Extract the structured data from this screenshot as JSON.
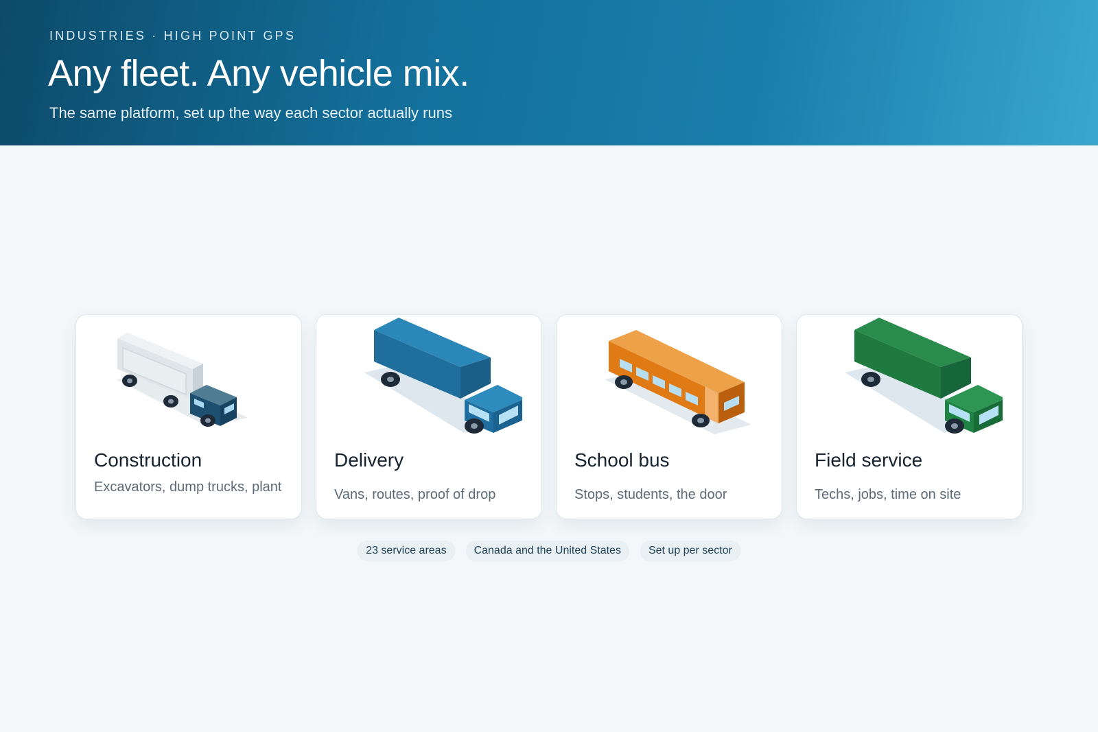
{
  "hero": {
    "eyebrow": "INDUSTRIES · HIGH POINT GPS",
    "title": "Any fleet. Any vehicle mix.",
    "subtitle": "The same platform, set up the way each sector actually runs"
  },
  "cards": [
    {
      "title": "Construction",
      "description": "Excavators, dump trucks, plant",
      "icon": "truck-icon",
      "color": "#e4e9ec"
    },
    {
      "title": "Delivery",
      "description": "Vans, routes, proof of drop",
      "icon": "truck-icon",
      "color": "#2477a8"
    },
    {
      "title": "School bus",
      "description": "Stops, students, the door",
      "icon": "bus-icon",
      "color": "#e58f2e"
    },
    {
      "title": "Field service",
      "description": "Techs, jobs, time on site",
      "icon": "truck-icon",
      "color": "#23874a"
    }
  ],
  "chips": [
    "23 service areas",
    "Canada and the United States",
    "Set up per sector"
  ]
}
